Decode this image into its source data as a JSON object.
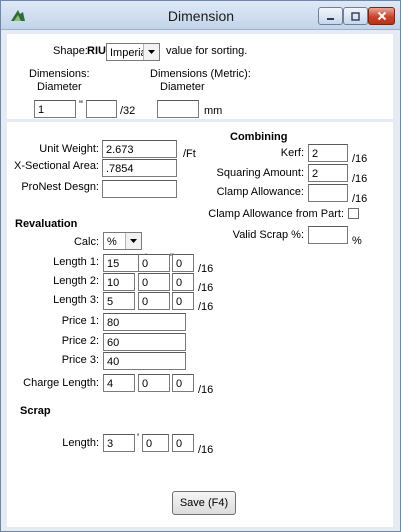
{
  "window": {
    "title": "Dimension"
  },
  "header": {
    "shape_label": "Shape:",
    "shape_value": "RIUse",
    "unit_value": "Imperial",
    "sort_hint": "value for sorting.",
    "dimensions_label": "Dimensions:",
    "diameter_label": "Diameter",
    "dimensions_metric_label": "Dimensions (Metric):",
    "diameter_metric_label": "Diameter",
    "diameter_whole": "1",
    "inch_mark": "\"",
    "diameter_fraction": "",
    "fraction_unit": "/32",
    "diameter_mm": "",
    "mm_unit": "mm"
  },
  "properties": {
    "unit_weight_label": "Unit Weight:",
    "unit_weight_value": "2.673",
    "unit_weight_unit": "/Ft",
    "xsection_label": "X-Sectional Area:",
    "xsection_value": ".7854",
    "pronest_label": "ProNest Desgn:",
    "pronest_value": ""
  },
  "combining": {
    "heading": "Combining",
    "kerf_label": "Kerf:",
    "kerf_value": "2",
    "kerf_unit": "/16",
    "squaring_label": "Squaring Amount:",
    "squaring_value": "2",
    "squaring_unit": "/16",
    "clamp_label": "Clamp Allowance:",
    "clamp_value": "",
    "clamp_unit": "/16",
    "clamp_part_label": "Clamp Allowance from Part:",
    "valid_scrap_label": "Valid Scrap %:",
    "valid_scrap_value": "",
    "valid_scrap_unit": "%"
  },
  "revaluation": {
    "heading": "Revaluation",
    "calc_label": "Calc:",
    "calc_value": "%",
    "length1_label": "Length 1:",
    "length1": [
      "15",
      "0",
      "0"
    ],
    "length2_label": "Length 2:",
    "length2": [
      "10",
      "0",
      "0"
    ],
    "length3_label": "Length 3:",
    "length3": [
      "5",
      "0",
      "0"
    ],
    "feet_mark": "'",
    "inch_mark": "\"",
    "sixteenths_unit": "/16",
    "price1_label": "Price 1:",
    "price1": "80",
    "price2_label": "Price 2:",
    "price2": "60",
    "price3_label": "Price 3:",
    "price3": "40",
    "charge_label": "Charge Length:",
    "charge": [
      "4",
      "0",
      "0"
    ]
  },
  "scrap": {
    "heading": "Scrap",
    "length_label": "Length:",
    "length": [
      "3",
      "0",
      "0"
    ]
  },
  "footer": {
    "save_label": "Save (F4)"
  }
}
